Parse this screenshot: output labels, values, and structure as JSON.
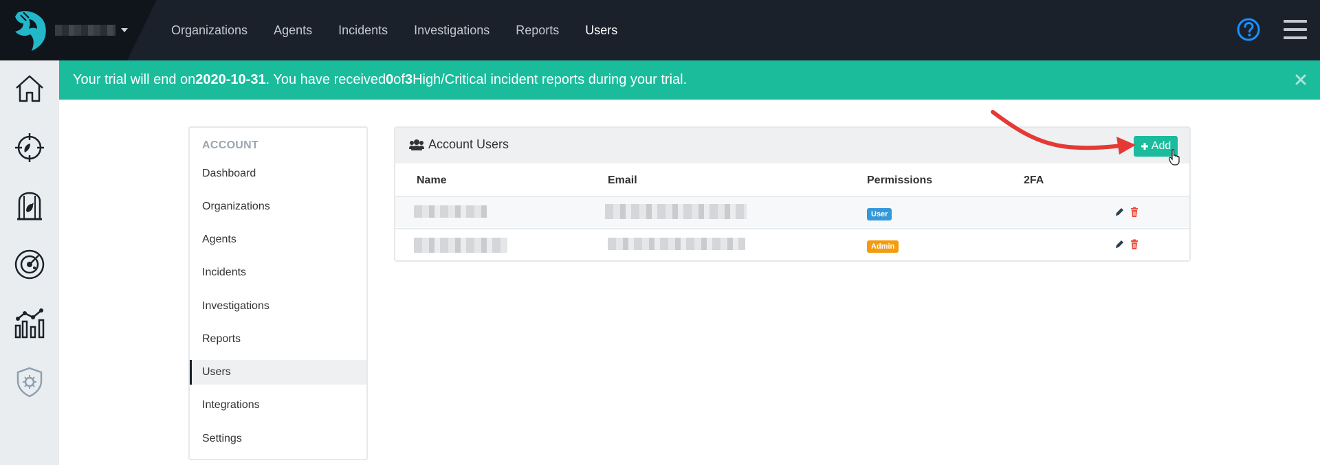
{
  "nav": {
    "items": [
      {
        "label": "Organizations"
      },
      {
        "label": "Agents"
      },
      {
        "label": "Incidents"
      },
      {
        "label": "Investigations"
      },
      {
        "label": "Reports"
      },
      {
        "label": "Users",
        "active": true
      }
    ]
  },
  "sidebar": {
    "icons": [
      "home-icon",
      "target-icon",
      "canary-cage-icon",
      "radar-icon",
      "analytics-icon",
      "shield-settings-icon"
    ]
  },
  "banner": {
    "part1": "Your trial will end on ",
    "date": "2020-10-31",
    "part2": ". You have received ",
    "received": "0",
    "part3": " of ",
    "total": "3",
    "part4": " High/Critical incident reports during your trial."
  },
  "account_menu": {
    "heading": "ACCOUNT",
    "items": [
      {
        "label": "Dashboard"
      },
      {
        "label": "Organizations"
      },
      {
        "label": "Agents"
      },
      {
        "label": "Incidents"
      },
      {
        "label": "Investigations"
      },
      {
        "label": "Reports"
      },
      {
        "label": "Users",
        "active": true
      },
      {
        "label": "Integrations"
      },
      {
        "label": "Settings"
      }
    ]
  },
  "users_panel": {
    "title": "Account Users",
    "add_label": "Add",
    "columns": {
      "name": "Name",
      "email": "Email",
      "permissions": "Permissions",
      "twofa": "2FA"
    },
    "rows": [
      {
        "permission": "User"
      },
      {
        "permission": "Admin"
      }
    ]
  },
  "colors": {
    "accent": "#1abc9c",
    "topbar": "#1b212a",
    "user_badge": "#3498db",
    "admin_badge": "#f39c12",
    "delete": "#e74c3c",
    "annotation_arrow": "#e53935"
  }
}
